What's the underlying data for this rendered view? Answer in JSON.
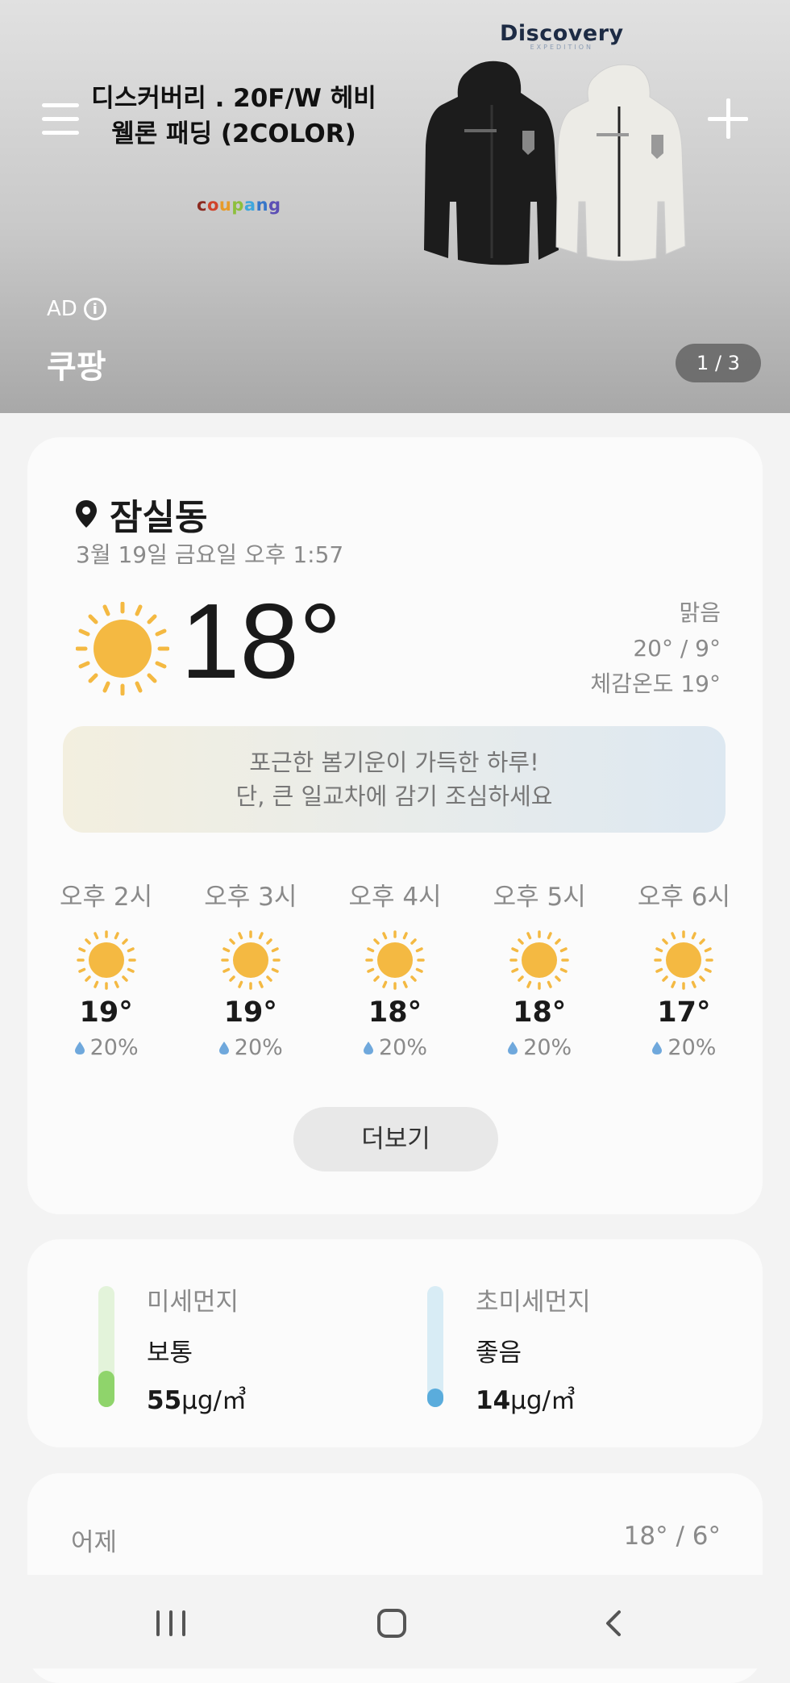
{
  "ad": {
    "title_line1": "디스커버리 . 20F/W 헤비",
    "title_line2": "웰론 패딩 (2COLOR)",
    "brand_logo": "Discovery",
    "brand_sub": "EXPEDITION",
    "store_logo_chars": [
      "c",
      "o",
      "u",
      "p",
      "a",
      "n",
      "g"
    ],
    "ad_label": "AD",
    "advertiser": "쿠팡",
    "pager": "1 / 3"
  },
  "weather": {
    "location": "잠실동",
    "datetime": "3월 19일 금요일 오후 1:57",
    "current_temp": "18°",
    "condition": "맑음",
    "high_low": "20° / 9°",
    "feels_like": "체감온도 19°",
    "message_line1": "포근한 봄기운이 가득한 하루!",
    "message_line2": "단, 큰 일교차에 감기 조심하세요",
    "hourly": [
      {
        "label": "오후 2시",
        "temp": "19°",
        "rain": "20%",
        "icon": "sun-icon"
      },
      {
        "label": "오후 3시",
        "temp": "19°",
        "rain": "20%",
        "icon": "sun-icon"
      },
      {
        "label": "오후 4시",
        "temp": "18°",
        "rain": "20%",
        "icon": "sun-icon"
      },
      {
        "label": "오후 5시",
        "temp": "18°",
        "rain": "20%",
        "icon": "sun-icon"
      },
      {
        "label": "오후 6시",
        "temp": "17°",
        "rain": "20%",
        "icon": "sun-icon"
      }
    ],
    "more_label": "더보기"
  },
  "dust": {
    "pm10": {
      "title": "미세먼지",
      "level": "보통",
      "value": "55",
      "unit": "μg/㎥",
      "level_fraction": 0.3,
      "color": "#8fd46b",
      "track_color": "#e3f3da"
    },
    "pm25": {
      "title": "초미세먼지",
      "level": "좋음",
      "value": "14",
      "unit": "μg/㎥",
      "level_fraction": 0.15,
      "color": "#5aacdc",
      "track_color": "#d8ecf5"
    }
  },
  "yesterday": {
    "label": "어제",
    "temp": "18° / 6°"
  },
  "colors": {
    "sun": "#f4b942",
    "accent_drop": "#6fa8dc"
  }
}
